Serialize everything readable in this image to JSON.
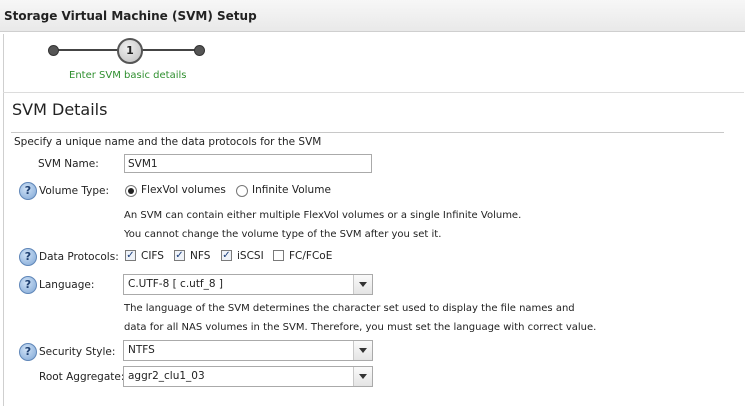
{
  "window": {
    "title": "Storage Virtual Machine (SVM) Setup"
  },
  "stepper": {
    "step_number": "1",
    "step_label": "Enter SVM basic details"
  },
  "section": {
    "title": "SVM Details",
    "description": "Specify a unique name and the data protocols for the SVM"
  },
  "form": {
    "svm_name": {
      "label": "SVM Name:",
      "value": "SVM1"
    },
    "volume_type": {
      "label": "Volume Type:",
      "options": [
        "FlexVol volumes",
        "Infinite Volume"
      ],
      "selected": "FlexVol volumes",
      "note1": "An SVM can contain either multiple FlexVol volumes or a single Infinite Volume.",
      "note2": "You cannot change the volume type of the SVM after you set it."
    },
    "data_protocols": {
      "label": "Data Protocols:",
      "items": [
        {
          "label": "CIFS",
          "checked": true
        },
        {
          "label": "NFS",
          "checked": true
        },
        {
          "label": "iSCSI",
          "checked": true
        },
        {
          "label": "FC/FCoE",
          "checked": false
        }
      ]
    },
    "language": {
      "label": "Language:",
      "value": "C.UTF-8 [ c.utf_8 ]",
      "note1": "The language of the SVM determines the character set used to display the file names and",
      "note2": "data for all NAS volumes in the SVM. Therefore, you must set the language with correct value."
    },
    "security_style": {
      "label": "Security Style:",
      "value": "NTFS"
    },
    "root_aggregate": {
      "label": "Root Aggregate:",
      "value": "aggr2_clu1_03"
    }
  },
  "icons": {
    "help": "help-icon",
    "dropdown": "chevron-down-icon"
  },
  "colors": {
    "step_label": "#2f8f2f",
    "help_icon": "#7fa6d4"
  }
}
